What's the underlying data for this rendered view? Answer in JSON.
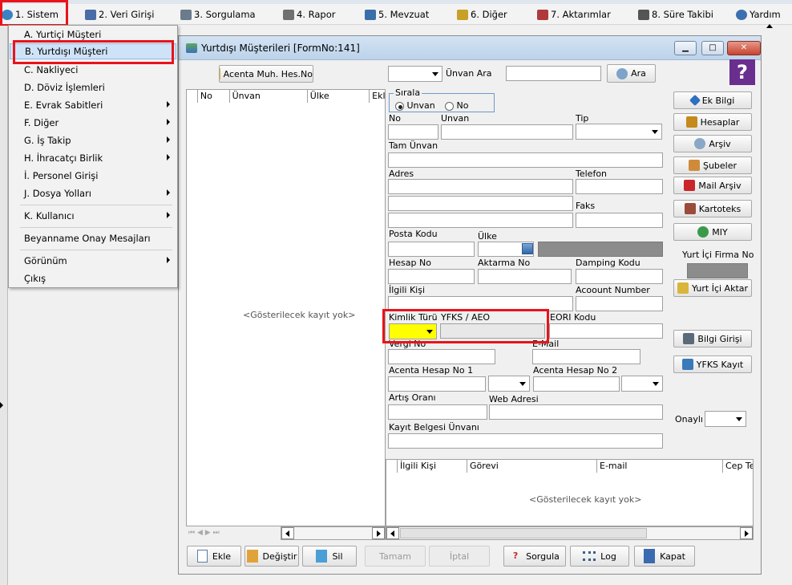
{
  "menubar": {
    "items": [
      {
        "label": "1.  Sistem",
        "icon": "gear-icon",
        "color": "#3b82c4"
      },
      {
        "label": "2.  Veri Girişi",
        "icon": "edit-icon",
        "color": "#4a6da7"
      },
      {
        "label": "3.  Sorgulama",
        "icon": "magnifier-icon",
        "color": "#6b7b8e"
      },
      {
        "label": "4.  Rapor",
        "icon": "printer-icon",
        "color": "#707070"
      },
      {
        "label": "5.  Mevzuat",
        "icon": "books-icon",
        "color": "#3a6ea8"
      },
      {
        "label": "6.  Diğer",
        "icon": "tools-icon",
        "color": "#c8a028"
      },
      {
        "label": "7.  Aktarımlar",
        "icon": "transfer-icon",
        "color": "#b03a3a"
      },
      {
        "label": "8. Süre Takibi",
        "icon": "clipboard-icon",
        "color": "#555555"
      },
      {
        "label": "Yardım",
        "icon": "help-icon",
        "color": "#3d6fb0"
      }
    ]
  },
  "dropdown": {
    "items": [
      {
        "label": "A.  Yurtiçi Müşteri",
        "submenu": false
      },
      {
        "label": "B.  Yurtdışı Müşteri",
        "submenu": false,
        "selected": true
      },
      {
        "label": "C.  Nakliyeci",
        "submenu": false
      },
      {
        "label": "D.  Döviz İşlemleri",
        "submenu": false
      },
      {
        "label": "E.  Evrak Sabitleri",
        "submenu": true
      },
      {
        "label": "F.  Diğer",
        "submenu": true
      },
      {
        "label": "G.  İş Takip",
        "submenu": true
      },
      {
        "label": "H.  İhracatçı Birlik",
        "submenu": true
      },
      {
        "label": "İ.   Personel Girişi",
        "submenu": false
      },
      {
        "label": "J.  Dosya Yolları",
        "submenu": true
      },
      {
        "label": "K.  Kullanıcı",
        "submenu": true
      },
      {
        "label": "Beyanname Onay Mesajları",
        "submenu": false
      },
      {
        "label": "Görünüm",
        "submenu": true
      },
      {
        "label": "Çıkış",
        "submenu": false
      }
    ]
  },
  "window": {
    "title": "Yurtdışı Müşterileri [FormNo:141]",
    "minimize": "▁",
    "maximize": "□",
    "close": "✕",
    "help_label": "?"
  },
  "toolbar": {
    "acenta_button": "Acenta Muh. Hes.No",
    "search_select_value": "",
    "search_label": "Ünvan Ara",
    "search_value": "",
    "ara_button": "Ara"
  },
  "left_grid": {
    "columns": [
      "No",
      "Ünvan",
      "Ülke",
      "Ekle"
    ],
    "empty_text": "<Gösterilecek kayıt yok>"
  },
  "form": {
    "sirala_legend": "Sırala",
    "radio_unvan": "Unvan",
    "radio_no": "No",
    "no_label": "No",
    "unvan_label": "Unvan",
    "tip_label": "Tip",
    "tam_unvan_label": "Tam Ünvan",
    "adres_label": "Adres",
    "telefon_label": "Telefon",
    "faks_label": "Faks",
    "posta_kodu_label": "Posta Kodu",
    "ulke_label": "Ülke",
    "hesap_no_label": "Hesap No",
    "aktarma_no_label": "Aktarma No",
    "damping_kodu_label": "Damping Kodu",
    "ilgili_kisi_label": "İlgili Kişi",
    "account_number_label": "Acoount Number",
    "kimlik_turu_label": "Kimlik Türü",
    "yfks_label": "YFKS / AEO",
    "eori_label": "EORI Kodu",
    "vergi_no_label": "Vergi No",
    "email_label": "E-Mail",
    "acenta1_label": "Acenta Hesap No 1",
    "acenta2_label": "Acenta Hesap No 2",
    "artis_label": "Artış Oranı",
    "web_label": "Web Adresi",
    "kayit_label": "Kayıt Belgesi Ünvanı",
    "kimlik_color": "#ffff00"
  },
  "right_buttons": {
    "ek_bilgi": "Ek Bilgi",
    "hesaplar": "Hesaplar",
    "arsiv": "Arşiv",
    "subeler": "Şubeler",
    "mail_arsiv": "Mail Arşiv",
    "kartoteks": "Kartoteks",
    "miy": "MIY",
    "yurt_ici_firma_label": "Yurt İçi Firma No",
    "yurt_ici_aktar": "Yurt İçi Aktar",
    "bilgi_girisi": "Bilgi Girişi",
    "yfks_kayit": "YFKS Kayıt",
    "onayli_label": "Onaylı"
  },
  "contacts_grid": {
    "columns": [
      "İlgili Kişi",
      "Görevi",
      "E-mail",
      "Cep Tel"
    ],
    "empty_text": "<Gösterilecek kayıt yok>"
  },
  "bottom_buttons": {
    "ekle": "Ekle",
    "degistir": "Değiştir",
    "sil": "Sil",
    "tamam": "Tamam",
    "iptal": "İptal",
    "sorgula": "Sorgula",
    "log": "Log",
    "kapat": "Kapat"
  },
  "colors": {
    "highlight_red": "#e8141a",
    "selection_blue": "#cfe3f8"
  }
}
